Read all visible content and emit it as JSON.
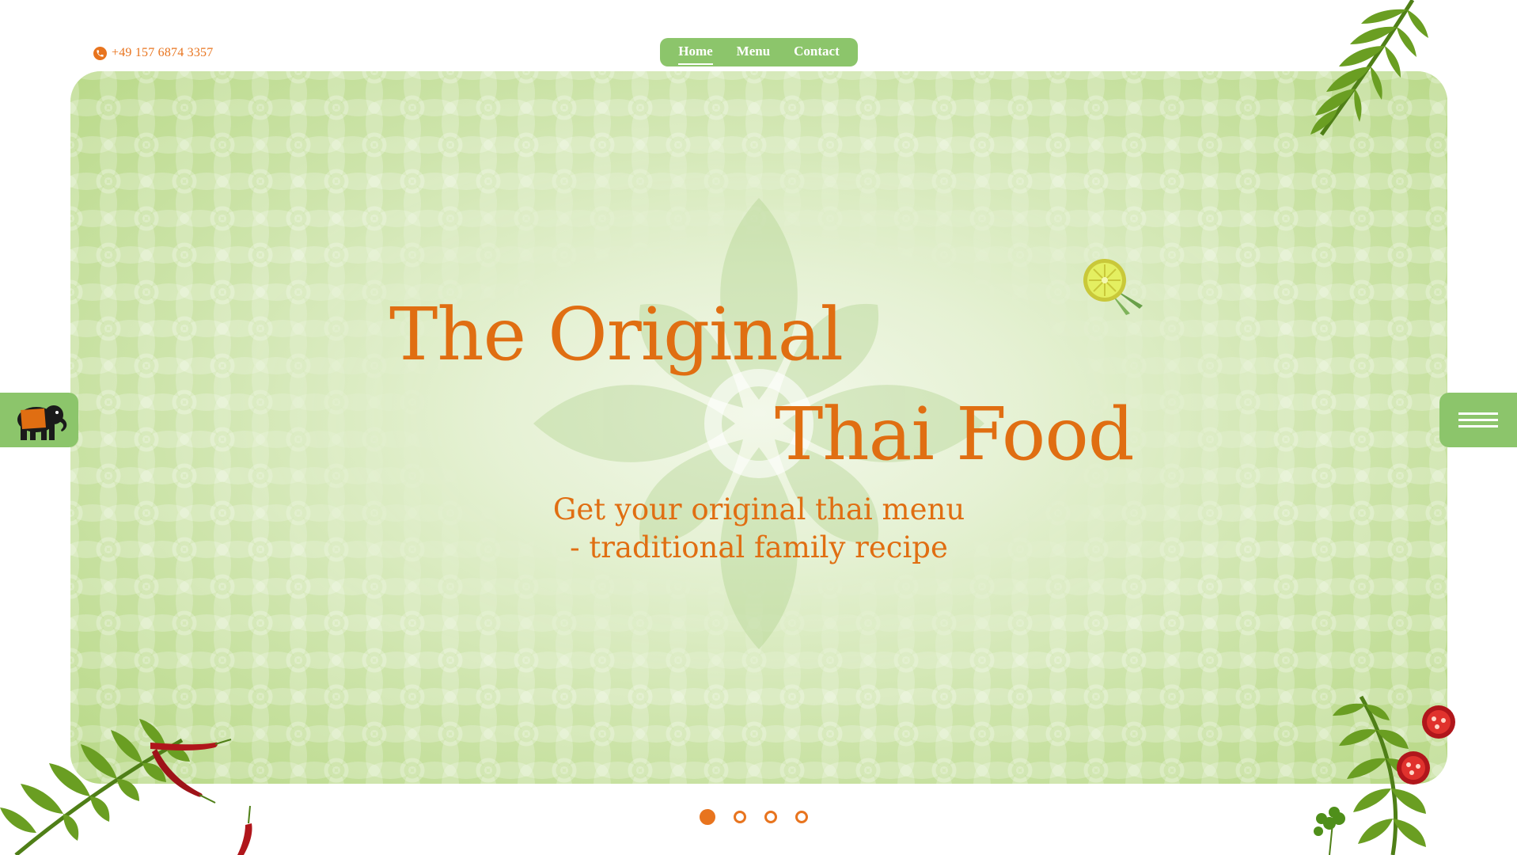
{
  "header": {
    "phone": "+49 157 6874 3357",
    "nav": [
      {
        "label": "Home",
        "active": true
      },
      {
        "label": "Menu",
        "active": false
      },
      {
        "label": "Contact",
        "active": false
      }
    ]
  },
  "hero": {
    "title_line1": "The Original",
    "title_line2": "Thai Food",
    "subtitle_line1": "Get your original thai menu",
    "subtitle_line2": "- traditional family recipe"
  },
  "carousel": {
    "slides": 4,
    "active_index": 0
  },
  "icons": {
    "phone": "phone-icon",
    "logo": "elephant-icon",
    "menu": "hamburger-icon",
    "decorations": [
      "fern-leaf",
      "chili-pepper",
      "lime-slice",
      "tomato-slice",
      "cilantro-leaf"
    ]
  },
  "colors": {
    "accent": "#e8741e",
    "brand_green": "#8cc56b",
    "hero_light": "#f3f8ea",
    "hero_dark": "#b7d885",
    "chili": "#b0161b",
    "leaf": "#5f9420"
  }
}
